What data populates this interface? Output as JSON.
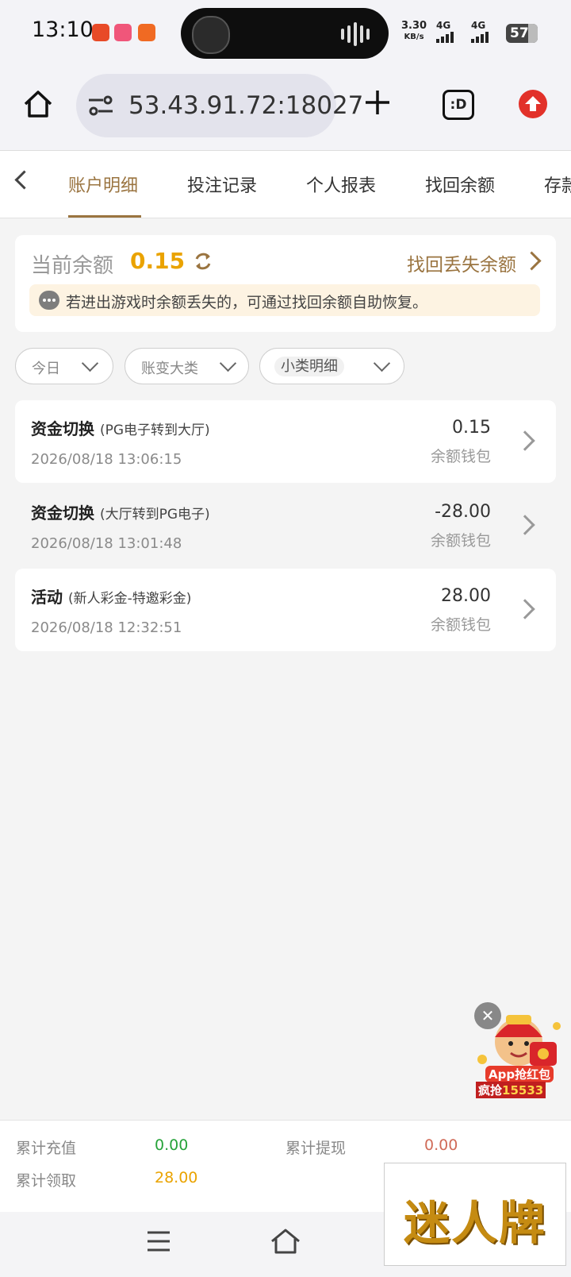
{
  "status_bar": {
    "time": "13:10",
    "speed_value": "3.30",
    "speed_unit": "KB/s",
    "net1": "4G",
    "net2": "4G",
    "battery": "57"
  },
  "browser": {
    "url": "53.43.91.72:18027",
    "tabs_label": ":D"
  },
  "tabs": [
    {
      "label": "账户明细",
      "active": true
    },
    {
      "label": "投注记录"
    },
    {
      "label": "个人报表"
    },
    {
      "label": "找回余额"
    },
    {
      "label": "存款"
    }
  ],
  "balance": {
    "label": "当前余额",
    "value": "0.15",
    "recover_label": "找回丢失余额",
    "tip": "若进出游戏时余额丢失的，可通过找回余额自助恢复。"
  },
  "filters": [
    {
      "label": "今日"
    },
    {
      "label": "账变大类"
    },
    {
      "label": "小类明细"
    }
  ],
  "records": [
    {
      "title": "资金切换",
      "detail": "(PG电子转到大厅)",
      "time": "2026/08/18 13:06:15",
      "amount": "0.15",
      "wallet": "余额钱包"
    },
    {
      "title": "资金切换",
      "detail": "(大厅转到PG电子)",
      "time": "2026/08/18 13:01:48",
      "amount": "-28.00",
      "wallet": "余额钱包"
    },
    {
      "title": "活动",
      "detail": "(新人彩金-特邀彩金)",
      "time": "2026/08/18 12:32:51",
      "amount": "28.00",
      "wallet": "余额钱包"
    }
  ],
  "ad": {
    "line1": "App抢红包",
    "line2_prefix": "疯抢",
    "line2_number": "15533",
    "close": "✕"
  },
  "summary": {
    "recharge_label": "累计充值",
    "recharge_value": "0.00",
    "withdraw_label": "累计提现",
    "withdraw_value": "0.00",
    "claim_label": "累计领取",
    "claim_value": "28.00"
  },
  "colors": {
    "accent": "#9a7440",
    "balance": "#eaa300",
    "green": "#27a33a",
    "red": "#d06b58"
  },
  "watermark": "迷人牌"
}
